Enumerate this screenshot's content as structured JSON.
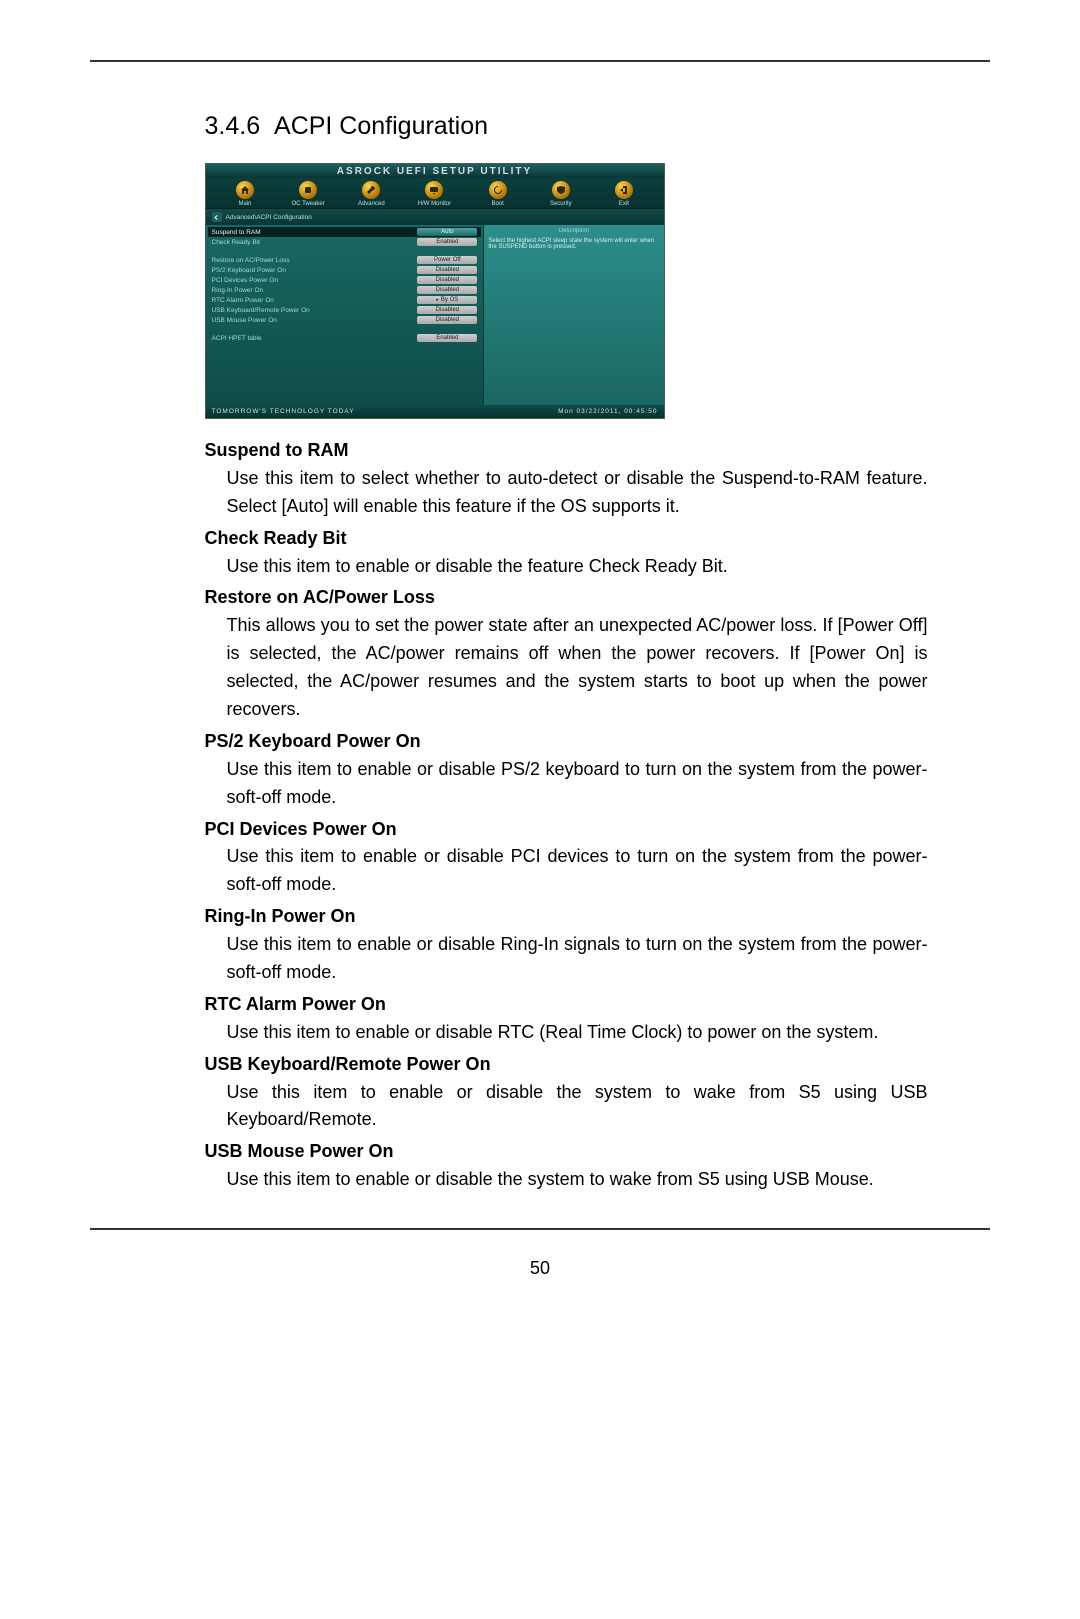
{
  "section": {
    "number": "3.4.6",
    "title": "ACPI Configuration"
  },
  "bios": {
    "titlebar": "ASROCK UEFI SETUP UTILITY",
    "tabs": [
      {
        "label": "Main",
        "icon": "home"
      },
      {
        "label": "OC Tweaker",
        "icon": "overclock"
      },
      {
        "label": "Advanced",
        "icon": "wrench"
      },
      {
        "label": "H/W Monitor",
        "icon": "monitor"
      },
      {
        "label": "Boot",
        "icon": "cycle"
      },
      {
        "label": "Security",
        "icon": "shield"
      },
      {
        "label": "Exit",
        "icon": "exit"
      }
    ],
    "breadcrumb": "Advanced\\ACPI Configuration",
    "rows": [
      {
        "label": "Suspend to RAM",
        "value": "Auto",
        "selected": true
      },
      {
        "label": "Check Ready Bit",
        "value": "Enabled"
      },
      {
        "label": "",
        "value": ""
      },
      {
        "label": "Restore on AC/Power Loss",
        "value": "Power Off"
      },
      {
        "label": "PS/2 Keyboard Power On",
        "value": "Disabled"
      },
      {
        "label": "PCI Devices Power On",
        "value": "Disabled"
      },
      {
        "label": "Ring-In Power On",
        "value": "Disabled"
      },
      {
        "label": "RTC Alarm Power On",
        "value": "By OS",
        "icon": true
      },
      {
        "label": "USB Keyboard/Remote Power On",
        "value": "Disabled"
      },
      {
        "label": "USB Mouse Power On",
        "value": "Disabled"
      },
      {
        "label": "",
        "value": ""
      },
      {
        "label": "ACPI HPET table",
        "value": "Enabled"
      }
    ],
    "description_title": "Description",
    "description_text": "Select the highest ACPI sleep state the system will enter when the SUSPEND button is pressed.",
    "footer_left": "TOMORROW'S TECHNOLOGY TODAY",
    "footer_right": "Mon 03/22/2011, 00:45:50"
  },
  "items": [
    {
      "head": "Suspend to RAM",
      "desc": "Use this item to select whether to auto-detect or disable the Suspend-to-RAM feature. Select [Auto] will enable this feature if the OS supports it."
    },
    {
      "head": "Check Ready Bit",
      "desc": "Use this item to enable or disable the feature Check Ready Bit."
    },
    {
      "head": "Restore on AC/Power Loss",
      "desc": "This allows you to set the power state after an unexpected AC/power loss. If [Power Off] is selected, the AC/power remains off when the power recovers. If [Power On] is selected, the AC/power resumes and the system starts to boot up when the power recovers."
    },
    {
      "head": "PS/2 Keyboard Power On",
      "desc": "Use this item to enable or disable PS/2 keyboard to turn on the system from the power-soft-off mode."
    },
    {
      "head": "PCI Devices Power On",
      "desc": "Use this item to enable or disable PCI devices to turn on the system from the power-soft-off mode."
    },
    {
      "head": "Ring-In Power On",
      "desc": "Use this item to enable or disable Ring-In signals to turn on the system from the power-soft-off mode."
    },
    {
      "head": "RTC Alarm Power On",
      "desc": "Use this item to enable or disable RTC (Real Time Clock) to power on the system."
    },
    {
      "head": "USB Keyboard/Remote Power On",
      "desc": "Use this item to enable or disable the system to wake from S5 using USB Keyboard/Remote."
    },
    {
      "head": "USB Mouse Power On",
      "desc": "Use this item to enable or disable the system to wake from S5 using USB Mouse."
    }
  ],
  "page_number": "50"
}
